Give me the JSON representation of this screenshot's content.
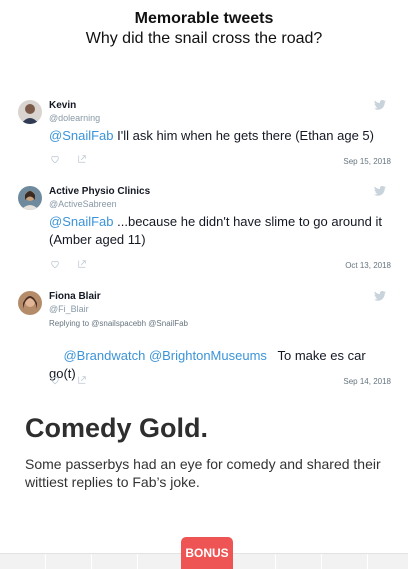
{
  "header": {
    "title": "Memorable tweets",
    "subtitle": "Why did the snail cross the road?"
  },
  "tweets": [
    {
      "name": "Kevin",
      "handle": "@dolearning",
      "mention": "@SnailFab",
      "text": " I'll ask him when he gets there (Ethan age 5)",
      "date": "Sep 15, 2018",
      "avatar_color": "#7b5a4a"
    },
    {
      "name": "Active Physio Clinics",
      "handle": "@ActiveSabreen",
      "mention": "@SnailFab",
      "text": " ...because he didn't have slime to go around it (Amber aged 11)",
      "date": "Oct 13, 2018",
      "avatar_color": "#c9a27a"
    },
    {
      "name": "Fiona Blair",
      "handle": "@Fi_Blair",
      "replying": "Replying to @snailspacebh @SnailFab",
      "mention1": "@Brandwatch",
      "mention2": "@BrightonMuseums",
      "text": "   To make es car go(t)",
      "date": "Sep 14, 2018",
      "avatar_color": "#4a2e24"
    }
  ],
  "section": {
    "heading": "Comedy Gold.",
    "description": "Some passerbys had an eye for comedy and shared their wittiest replies to Fab’s joke."
  },
  "bonus_label": "BONUS",
  "colors": {
    "mention": "#3b94d9",
    "bonus": "#ee5454",
    "muted": "#8899a6"
  }
}
